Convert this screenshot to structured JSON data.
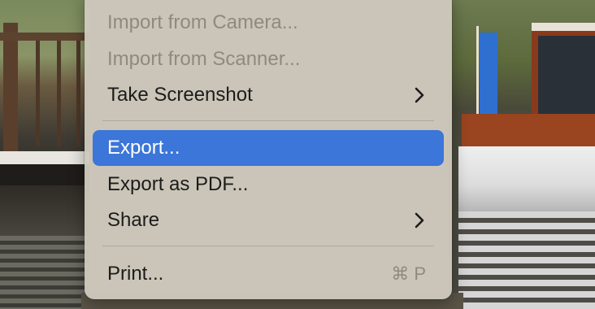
{
  "menu": {
    "items": [
      {
        "label": "Import from Camera...",
        "enabled": false
      },
      {
        "label": "Import from Scanner...",
        "enabled": false
      },
      {
        "label": "Take Screenshot",
        "enabled": true,
        "submenu": true
      },
      {
        "label": "Export...",
        "enabled": true,
        "selected": true
      },
      {
        "label": "Export as PDF...",
        "enabled": true
      },
      {
        "label": "Share",
        "enabled": true,
        "submenu": true
      },
      {
        "label": "Print...",
        "enabled": true,
        "shortcut": "⌘ P"
      }
    ],
    "icons": {
      "submenu": "chevron-right-icon"
    },
    "colors": {
      "highlight": "#3b76d8",
      "menu_bg": "#cec9bc",
      "disabled_text": "#8e8a80"
    }
  }
}
